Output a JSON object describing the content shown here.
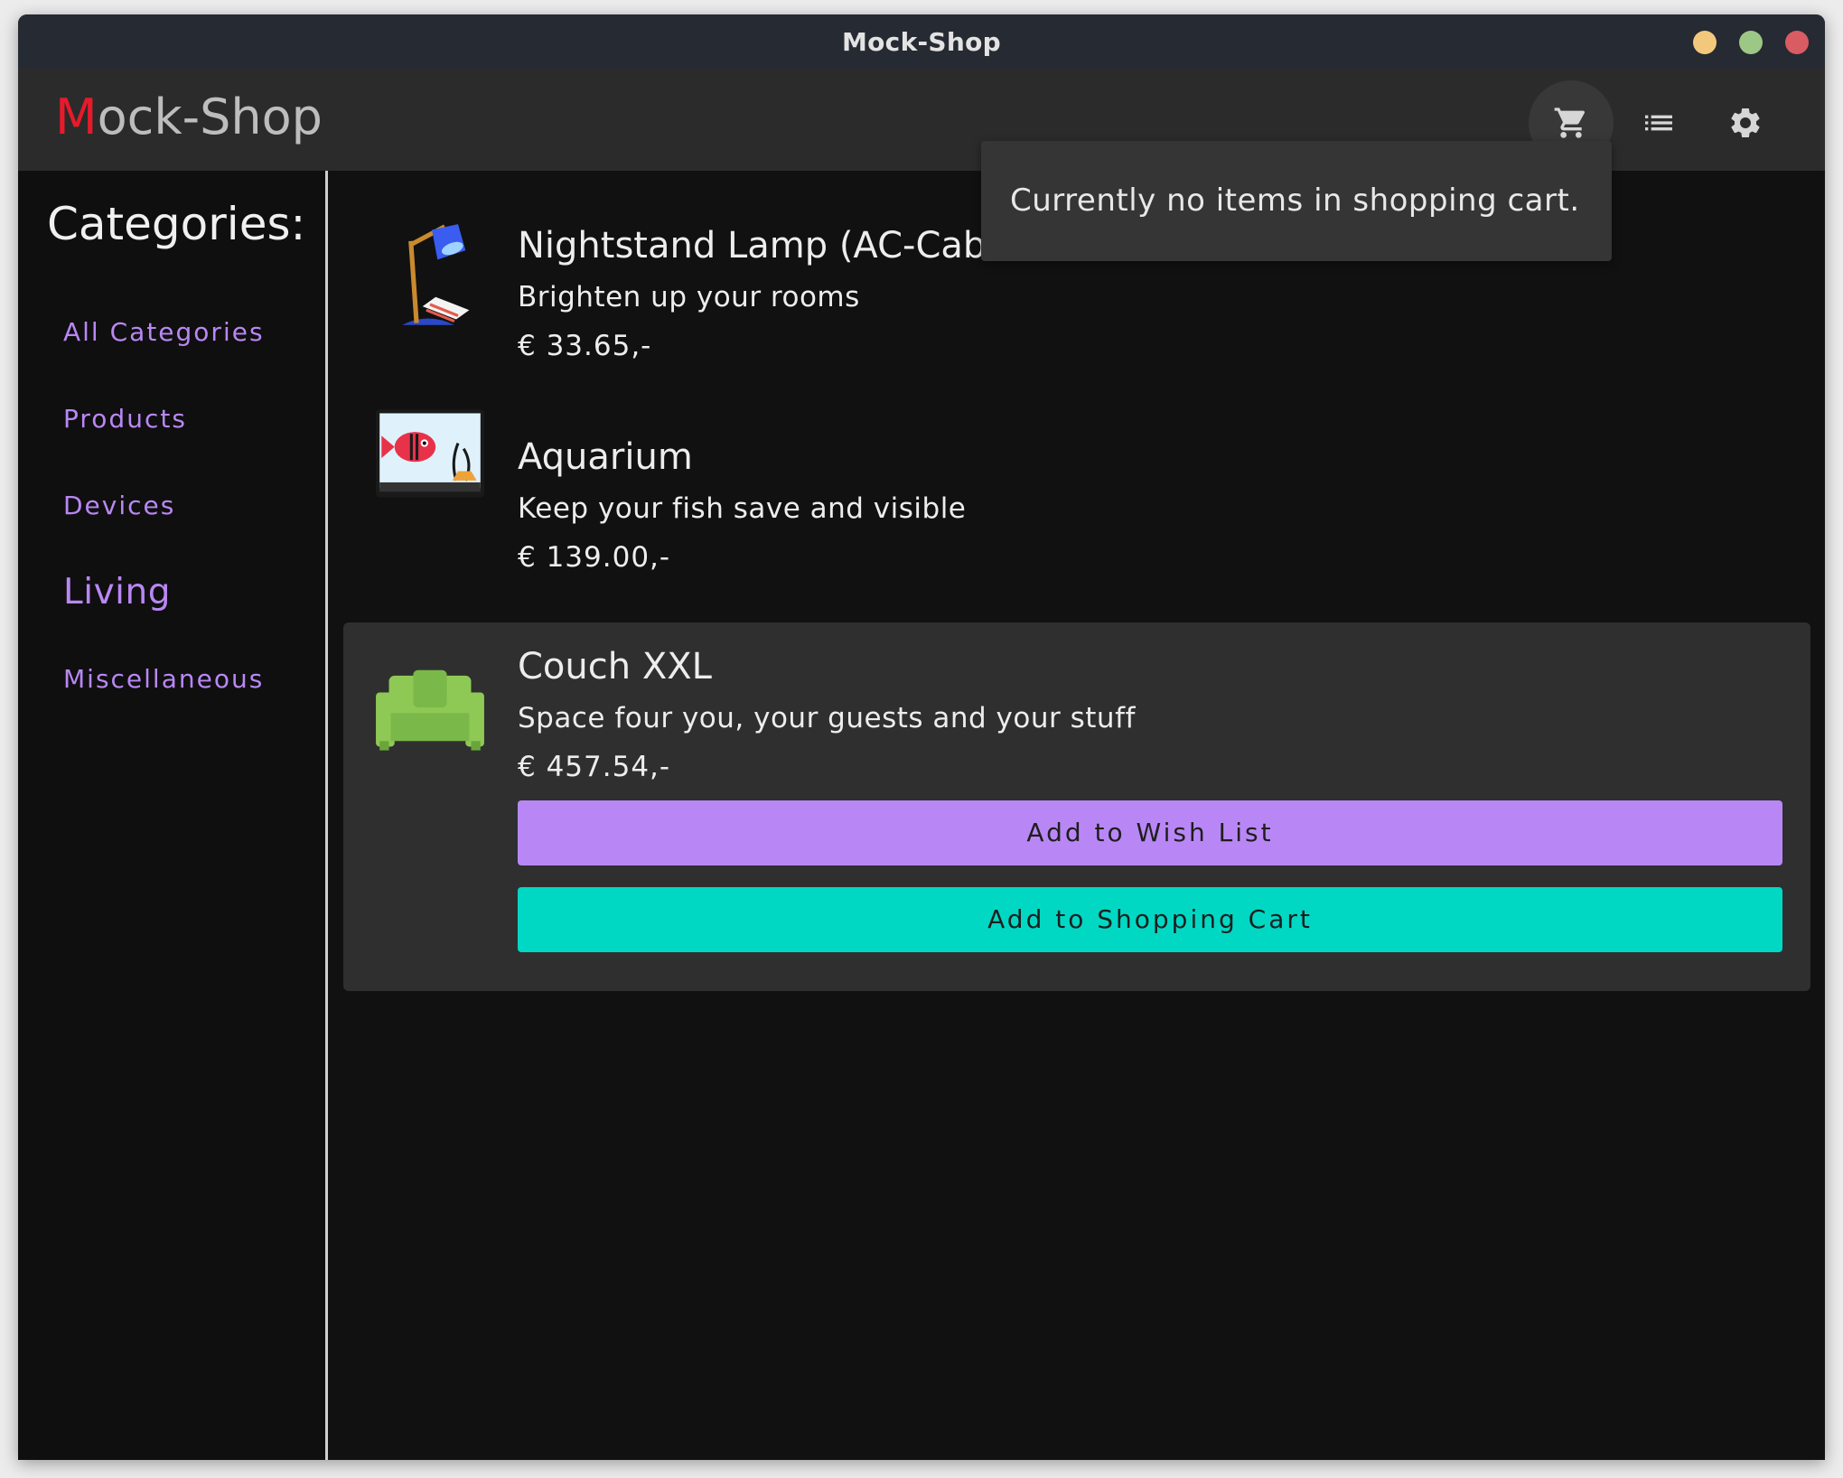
{
  "window": {
    "title": "Mock-Shop"
  },
  "appbar": {
    "logo_initial": "M",
    "logo_rest": "ock-Shop",
    "cart_icon": "shopping-cart-icon",
    "list_icon": "list-icon",
    "settings_icon": "gear-icon"
  },
  "sidebar": {
    "heading": "Categories:",
    "items": [
      {
        "label": "All Categories",
        "active": false
      },
      {
        "label": "Products",
        "active": false
      },
      {
        "label": "Devices",
        "active": false
      },
      {
        "label": "Living",
        "active": true
      },
      {
        "label": "Miscellaneous",
        "active": false
      }
    ]
  },
  "products": [
    {
      "name": "Nightstand Lamp (AC-Cab",
      "description": "Brighten up your rooms",
      "price": "€ 33.65,-",
      "icon": "lamp-icon"
    },
    {
      "name": "Aquarium",
      "description": "Keep your fish save and visible",
      "price": "€ 139.00,-",
      "icon": "aquarium-icon"
    },
    {
      "name": "Couch XXL",
      "description": "Space four you, your guests and your stuff",
      "price": "€ 457.54,-",
      "icon": "couch-icon",
      "wish_label": "Add to Wish List",
      "cart_label": "Add to Shopping Cart"
    }
  ],
  "cart_popover": {
    "message": "Currently no items in shopping cart."
  },
  "colors": {
    "accent_purple": "#b987f5",
    "accent_teal": "#00d8c4",
    "logo_red": "#e81a2a"
  }
}
